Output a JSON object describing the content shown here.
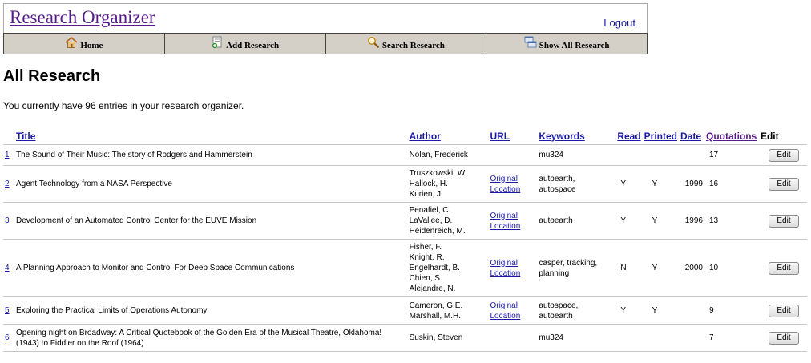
{
  "header": {
    "app_title": "Research Organizer",
    "logout_label": "Logout"
  },
  "nav": [
    {
      "label": "Home",
      "icon": "home-icon"
    },
    {
      "label": "Add Research",
      "icon": "add-research-icon"
    },
    {
      "label": "Search Research",
      "icon": "magnifier-icon"
    },
    {
      "label": "Show All Research",
      "icon": "windows-icon"
    }
  ],
  "page_title": "All Research",
  "summary": "You currently have 96 entries in your research organizer.",
  "columns": {
    "title": "Title",
    "author": "Author",
    "url": "URL",
    "keywords": "Keywords",
    "read": "Read",
    "printed": "Printed",
    "date": "Date",
    "quotations": "Quotations",
    "edit": "Edit"
  },
  "rows": [
    {
      "num": "1",
      "title": "The Sound of Their Music: The story of Rodgers and Hammerstein",
      "author_lines": [
        "Nolan, Frederick"
      ],
      "url_lines": [],
      "keyword_lines": [
        "mu324"
      ],
      "read": "",
      "printed": "",
      "date": "",
      "quotations": "17",
      "edit_label": "Edit"
    },
    {
      "num": "2",
      "title": "Agent Technology from a NASA Perspective",
      "author_lines": [
        "Truszkowski, W.",
        "Hallock, H.",
        "Kurien, J."
      ],
      "url_lines": [
        "Original",
        "Location"
      ],
      "keyword_lines": [
        "autoearth,",
        "autospace"
      ],
      "read": "Y",
      "printed": "Y",
      "date": "1999",
      "quotations": "16",
      "edit_label": "Edit"
    },
    {
      "num": "3",
      "title": "Development of an Automated Control Center for the EUVE Mission",
      "author_lines": [
        "Penafiel, C.",
        "LaVallee, D.",
        "Heidenreich, M."
      ],
      "url_lines": [
        "Original",
        "Location"
      ],
      "keyword_lines": [
        "autoearth"
      ],
      "read": "Y",
      "printed": "Y",
      "date": "1996",
      "quotations": "13",
      "edit_label": "Edit"
    },
    {
      "num": "4",
      "title": "A Planning Approach to Monitor and Control For Deep Space Communications",
      "author_lines": [
        "Fisher, F.",
        "Knight, R.",
        "Engelhardt, B.",
        "Chien, S.",
        "Alejandre, N."
      ],
      "url_lines": [
        "Original",
        "Location"
      ],
      "keyword_lines": [
        "casper, tracking,",
        "planning"
      ],
      "read": "N",
      "printed": "Y",
      "date": "2000",
      "quotations": "10",
      "edit_label": "Edit"
    },
    {
      "num": "5",
      "title": "Exploring the Practical Limits of Operations Autonomy",
      "author_lines": [
        "Cameron, G.E.",
        "Marshall, M.H."
      ],
      "url_lines": [
        "Original",
        "Location"
      ],
      "keyword_lines": [
        "autospace,",
        "autoearth"
      ],
      "read": "Y",
      "printed": "Y",
      "date": "",
      "quotations": "9",
      "edit_label": "Edit"
    },
    {
      "num": "6",
      "title": "Opening night on Broadway: A Critical Quotebook of the Golden Era of the Musical Theatre, Oklahoma! (1943) to Fiddler on the Roof (1964)",
      "author_lines": [
        "Suskin, Steven"
      ],
      "url_lines": [],
      "keyword_lines": [
        "mu324"
      ],
      "read": "",
      "printed": "",
      "date": "",
      "quotations": "7",
      "edit_label": "Edit"
    }
  ]
}
